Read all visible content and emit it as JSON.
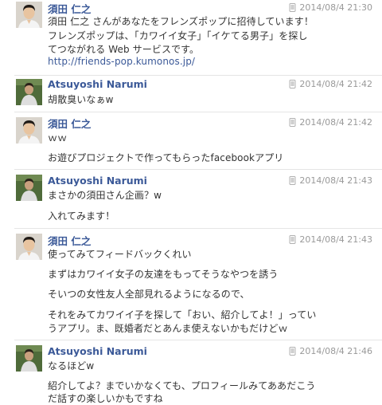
{
  "messages": [
    {
      "sender": "須田 仁之",
      "timestamp": "2014/08/4 21:30",
      "avatar": "person-white-shirt",
      "lines": [
        "須田 仁之 さんがあなたをフレンズポップに招待しています！",
        "フレンズポップは、「カワイイ女子」「イケてる男子」を探し",
        "てつながれる Web サービスです。"
      ],
      "link": "http://friends-pop.kumonos.jp/"
    },
    {
      "sender": "Atsuyoshi Narumi",
      "timestamp": "2014/08/4 21:42",
      "avatar": "person-green-background",
      "lines": [
        "胡散臭いなぁw"
      ]
    },
    {
      "sender": "須田 仁之",
      "timestamp": "2014/08/4 21:42",
      "avatar": "person-white-shirt",
      "lines": [
        "ｗｗ",
        "お遊びプロジェクトで作ってもらったfacebookアプリ"
      ]
    },
    {
      "sender": "Atsuyoshi Narumi",
      "timestamp": "2014/08/4 21:43",
      "avatar": "person-green-background",
      "lines": [
        "まさかの須田さん企画？w",
        "入れてみます！"
      ]
    },
    {
      "sender": "須田 仁之",
      "timestamp": "2014/08/4 21:43",
      "avatar": "person-white-shirt",
      "lines": [
        "使ってみてフィードバックくれい",
        "まずはカワイイ女子の友達をもってそうなやつを誘う",
        "そいつの女性友人全部見れるようになるので、",
        "それをみてカワイイ子を探して「おい、紹介してよ！」ってい",
        "うアプリ。ま、既婚者だとあんま使えないかもだけどｗ"
      ]
    },
    {
      "sender": "Atsuyoshi Narumi",
      "timestamp": "2014/08/4 21:46",
      "avatar": "person-green-background",
      "lines": [
        "なるほどw",
        "紹介してよ？までいかなくても、プロフィールみてああだこう",
        "だ話すの楽しいかもですね"
      ]
    }
  ],
  "icons": {
    "device": "mobile-phone-icon"
  },
  "colors": {
    "name": "#3b5998",
    "text": "#333333",
    "meta": "#999999",
    "link": "#3b5998"
  }
}
